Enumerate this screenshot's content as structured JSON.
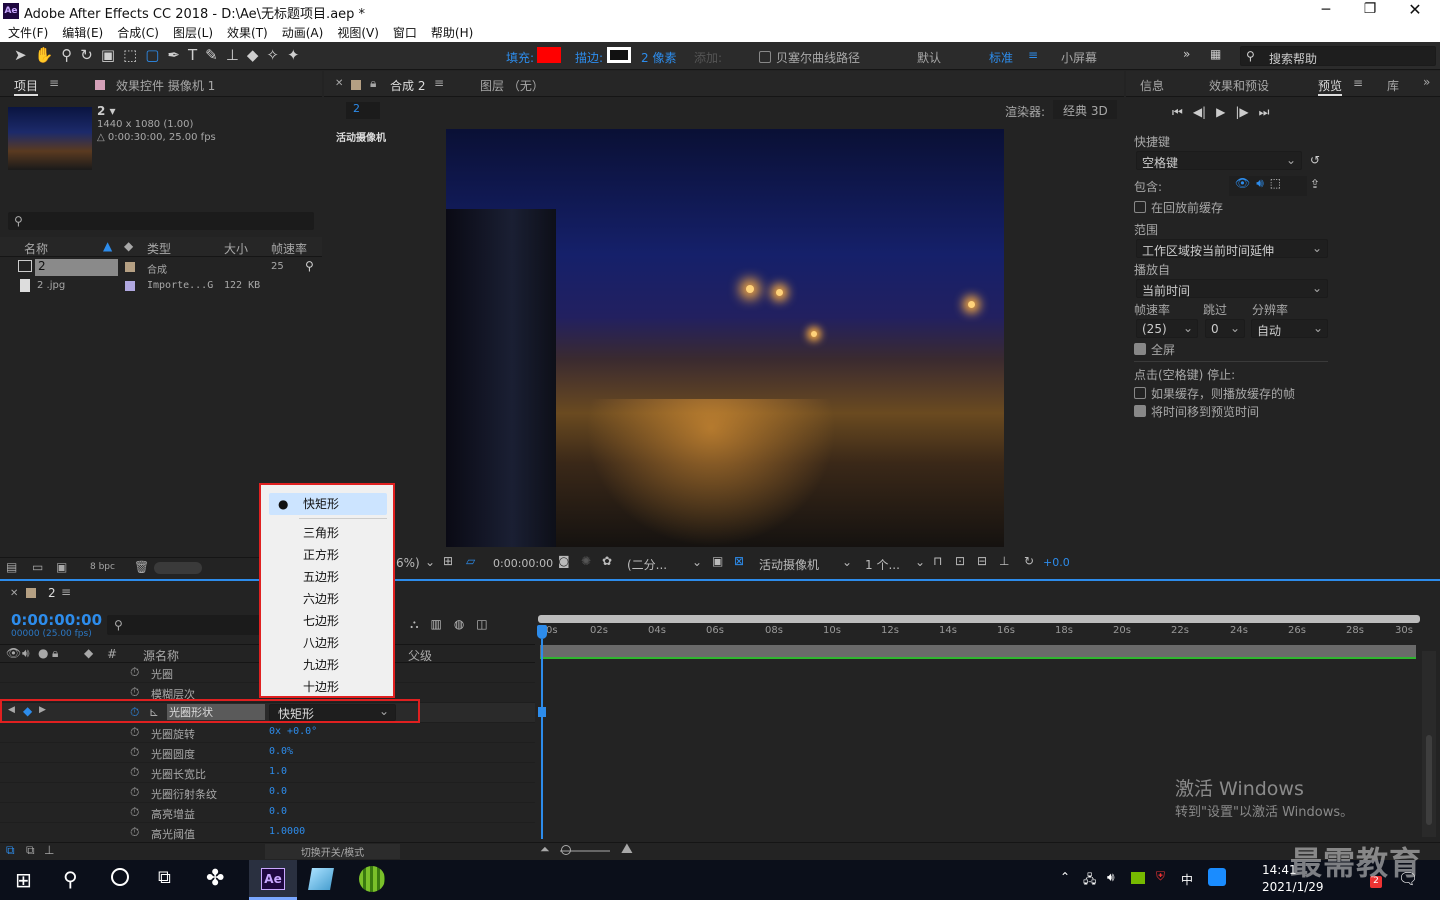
{
  "window": {
    "title": "Adobe After Effects CC 2018 - D:\\Ae\\无标题项目.aep *",
    "app_icon_text": "Ae"
  },
  "menu": [
    "文件(F)",
    "编辑(E)",
    "合成(C)",
    "图层(L)",
    "效果(T)",
    "动画(A)",
    "视图(V)",
    "窗口",
    "帮助(H)"
  ],
  "toolbar": {
    "fill_label": "填充:",
    "stroke_label": "描边:",
    "stroke_px": "2 像素",
    "add_label": "添加:",
    "bezier_label": "贝塞尔曲线路径",
    "workspace_default": "默认",
    "workspace_standard": "标准",
    "workspace_small": "小屏幕",
    "search_placeholder": "搜索帮助",
    "fill_color": "#ff0000"
  },
  "project_panel": {
    "tab_project": "项目",
    "tab_effects": "效果控件 摄像机 1",
    "item_name": "2 ▾",
    "item_info1": "1440 x 1080 (1.00)",
    "item_info2": "△ 0:00:30:00, 25.00 fps",
    "columns": {
      "name": "名称",
      "type": "类型",
      "size": "大小",
      "fps": "帧速率"
    },
    "rows": [
      {
        "name": "2",
        "type": "合成",
        "size": "",
        "fps": "25"
      },
      {
        "name": "2 .jpg",
        "type": "Importe...G",
        "size": "122 KB",
        "fps": ""
      }
    ],
    "bpc": "8 bpc"
  },
  "comp_panel": {
    "tab_comp": "合成 2",
    "tab_layer": "图层 （无）",
    "sub_tab": "2",
    "renderer_label": "渲染器:",
    "renderer_value": "经典 3D",
    "camera_label": "活动摄像机",
    "zoom": "6%)",
    "timecode": "0:00:00:00",
    "resolution": "(二分...",
    "view": "活动摄像机",
    "views": "1 个...",
    "exposure": "+0.0"
  },
  "right_panel": {
    "tabs": [
      "信息",
      "效果和预设",
      "预览",
      "库"
    ],
    "shortcut_label": "快捷键",
    "shortcut_value": "空格键",
    "include_label": "包含:",
    "cache_label": "在回放前缓存",
    "range_label": "范围",
    "range_value": "工作区域按当前时间延伸",
    "play_from_label": "播放自",
    "play_from_value": "当前时间",
    "fps_label": "帧速率",
    "skip_label": "跳过",
    "res_label": "分辨率",
    "fps_value": "(25)",
    "skip_value": "0",
    "res_value": "自动",
    "fullscreen_label": "全屏",
    "stop_label": "点击(空格键) 停止:",
    "if_cache_label": "如果缓存，则播放缓存的帧",
    "move_time_label": "将时间移到预览时间"
  },
  "timeline": {
    "tab": "2",
    "timecode": "0:00:00:00",
    "sub_timecode": "00000 (25.00 fps)",
    "col_source": "源名称",
    "col_parent": "父级",
    "ruler": [
      "0s",
      "02s",
      "04s",
      "06s",
      "08s",
      "10s",
      "12s",
      "14s",
      "16s",
      "18s",
      "20s",
      "22s",
      "24s",
      "26s",
      "28s",
      "30s"
    ],
    "props": [
      {
        "name": "光圈",
        "value": ""
      },
      {
        "name": "模糊层次",
        "value": ""
      },
      {
        "name": "光圈形状",
        "value": "快矩形"
      },
      {
        "name": "光圈旋转",
        "value": "0x +0.0°"
      },
      {
        "name": "光圈圆度",
        "value": "0.0%"
      },
      {
        "name": "光圈长宽比",
        "value": "1.0"
      },
      {
        "name": "光圈衍射条纹",
        "value": "0.0"
      },
      {
        "name": "高亮增益",
        "value": "0.0"
      },
      {
        "name": "高光阈值",
        "value": "1.0000"
      }
    ],
    "footer": "切换开关/模式"
  },
  "dropdown": {
    "items": [
      "快矩形",
      "三角形",
      "正方形",
      "五边形",
      "六边形",
      "七边形",
      "八边形",
      "九边形",
      "十边形"
    ],
    "selected": "快矩形"
  },
  "watermark": {
    "line1": "激活 Windows",
    "line2": "转到\"设置\"以激活 Windows。",
    "brand": "最需教育"
  },
  "taskbar": {
    "time": "14:41",
    "date": "2021/1/29",
    "ime": "中",
    "notif": "2"
  }
}
